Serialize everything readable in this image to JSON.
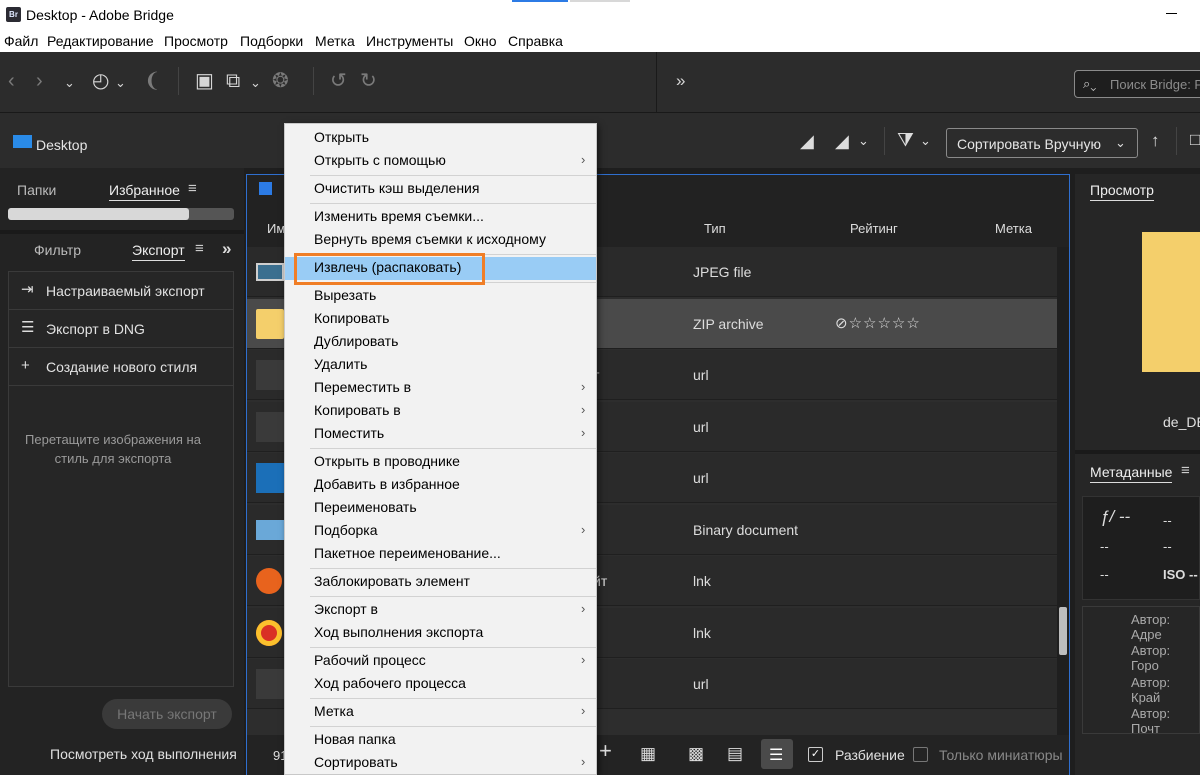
{
  "window": {
    "app_badge": "Br",
    "title": "Desktop - Adobe Bridge"
  },
  "menubar": [
    "Файл",
    "Редактирование",
    "Просмотр",
    "Подборки",
    "Метка",
    "Инструменты",
    "Окно",
    "Справка"
  ],
  "toolbar": {
    "more": "»",
    "search_placeholder": "Поиск Bridge: Ра"
  },
  "path": {
    "label": "Desktop"
  },
  "sort": {
    "label": "Сортировать Вручную"
  },
  "left": {
    "tabs_top": [
      "Папки",
      "Избранное"
    ],
    "favorites_progress": 0.8,
    "tabs_mid": [
      "Фильтр",
      "Экспорт"
    ],
    "export_items": [
      {
        "icon": "export-icon",
        "label": "Настраиваемый экспорт"
      },
      {
        "icon": "list-icon",
        "label": "Экспорт в DNG"
      },
      {
        "icon": "plus-icon",
        "label": "Создание нового стиля"
      }
    ],
    "drop_hint": "Перетащите изображения на стиль для экспорта",
    "start_export": "Начать экспорт",
    "view_progress": "Посмотреть ход выполнения"
  },
  "content": {
    "columns": [
      "Им",
      "Тип",
      "Рейтинг",
      "Метка"
    ],
    "rows": [
      {
        "thumb": "image",
        "frag": "",
        "type": "JPEG file",
        "rating": ""
      },
      {
        "thumb": "zip",
        "frag": "",
        "type": "ZIP archive",
        "rating": "⊘☆☆☆☆☆"
      },
      {
        "thumb": "url",
        "frag": "т",
        "type": "url",
        "rating": ""
      },
      {
        "thumb": "url",
        "frag": "",
        "type": "url",
        "rating": ""
      },
      {
        "thumb": "concur",
        "frag": "",
        "type": "url",
        "rating": ""
      },
      {
        "thumb": "bin",
        "frag": "",
        "type": "Binary document",
        "rating": ""
      },
      {
        "thumb": "firefox",
        "frag": "йт",
        "type": "lnk",
        "rating": ""
      },
      {
        "thumb": "chrome",
        "frag": "",
        "type": "lnk",
        "rating": ""
      },
      {
        "thumb": "url",
        "frag": "",
        "type": "url",
        "rating": ""
      }
    ],
    "status_count": "91",
    "split_label": "Разбиение",
    "thumbs_only_label": "Только миниатюры"
  },
  "right": {
    "preview_tab": "Просмотр",
    "preview_filename": "de_DE",
    "metadata_tab": "Метаданные",
    "exif": [
      "ƒ/ --",
      "--",
      "--",
      "--",
      "--",
      "ISO --"
    ],
    "authors": [
      "Автор: Адре",
      "Автор: Горо",
      "Автор: Край",
      "Автор: Почт"
    ]
  },
  "context_menu": {
    "groups": [
      [
        {
          "label": "Открыть"
        },
        {
          "label": "Открыть с помощью",
          "submenu": true
        }
      ],
      [
        {
          "label": "Очистить кэш выделения"
        }
      ],
      [
        {
          "label": "Изменить время съемки..."
        },
        {
          "label": "Вернуть время съемки к исходному"
        }
      ],
      [
        {
          "label": "Извлечь (распаковать)",
          "highlighted": true
        }
      ],
      [
        {
          "label": "Вырезать"
        },
        {
          "label": "Копировать"
        },
        {
          "label": "Дублировать"
        },
        {
          "label": "Удалить"
        },
        {
          "label": "Переместить в",
          "submenu": true
        },
        {
          "label": "Копировать в",
          "submenu": true
        },
        {
          "label": "Поместить",
          "submenu": true
        }
      ],
      [
        {
          "label": "Открыть в проводнике"
        },
        {
          "label": "Добавить в избранное"
        },
        {
          "label": "Переименовать"
        },
        {
          "label": "Подборка",
          "submenu": true
        },
        {
          "label": "Пакетное переименование..."
        }
      ],
      [
        {
          "label": "Заблокировать элемент"
        }
      ],
      [
        {
          "label": "Экспорт в",
          "submenu": true
        },
        {
          "label": "Ход выполнения экспорта"
        }
      ],
      [
        {
          "label": "Рабочий процесс",
          "submenu": true
        },
        {
          "label": "Ход рабочего процесса"
        }
      ],
      [
        {
          "label": "Метка",
          "submenu": true
        }
      ],
      [
        {
          "label": "Новая папка"
        },
        {
          "label": "Сортировать",
          "submenu": true
        }
      ]
    ]
  },
  "colors": {
    "accent": "#2c7be5",
    "menu_highlight": "#99ccf5",
    "callout": "#f07e26",
    "zip_folder": "#f4cf6b"
  }
}
